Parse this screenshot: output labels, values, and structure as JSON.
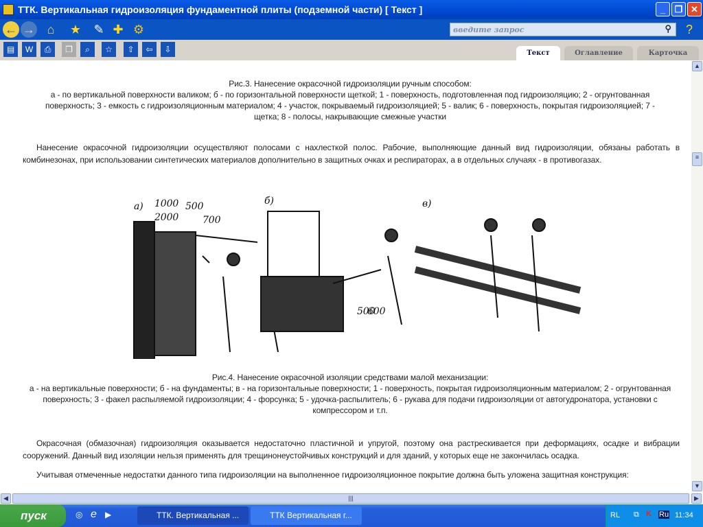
{
  "window": {
    "title": "ТТК. Вертикальная гидроизоляция фундаментной плиты (подземной части) [ Текст ]",
    "minimize": "_",
    "restore": "❐",
    "close": "✕"
  },
  "toolbar": {
    "search_placeholder": "введите запрос"
  },
  "tabs": [
    {
      "label": "Текст"
    },
    {
      "label": "Оглавление"
    },
    {
      "label": "Карточка"
    }
  ],
  "content": {
    "fig3_title": "Рис.3. Нанесение окрасочной гидроизоляции ручным способом:",
    "fig3_legend": "а - по вертикальной поверхности валиком; б - по горизонтальной поверхности щеткой; 1 - поверхность, подготовленная под гидроизоляцию; 2 - огрунтованная поверхность; 3 - емкость с гидроизоляционным материалом; 4 - участок, покрываемый гидроизоляцией; 5 - валик; 6 - поверхность, покрытая гидроизоляцией; 7 - щетка; 8 - полосы, накрывающие смежные участки",
    "para1": "Нанесение окрасочной гидроизоляции осуществляют полосами с нахлесткой полос. Рабочие, выполняющие данный вид гидроизоляции, обязаны работать в комбинезонах, при использовании синтетических материалов дополнительно в защитных очках и респираторах, а в отдельных случаях - в противогазах.",
    "figure_labels": {
      "a": "а)",
      "b": "б)",
      "c": "в)",
      "d1000": "1000",
      "d500": "500",
      "d2000": "2000",
      "d700": "700",
      "d500b": "500",
      "d600": "600"
    },
    "fig4_title": "Рис.4. Нанесение окрасочной изоляции средствами малой механизации:",
    "fig4_legend": "а - на вертикальные поверхности; б - на фундаменты; в - на горизонтальные поверхности; 1 - поверхность, покрытая гидроизоляционным материалом; 2 - огрунтованная поверхность; 3 - факел распыляемой гидроизоляции; 4 - форсунка; 5 - удочка-распылитель; 6 - рукава для подачи гидроизоляции от автогудронатора, установки с компрессором и т.п.",
    "para2": "Окрасочная (обмазочная) гидроизоляция оказывается недостаточно пластичной и упругой, поэтому она растрескивается при деформациях, осадке и вибрации сооружений. Данный вид изоляции нельзя применять для трещинонеустойчивых конструкций и для зданий, у которых еще не закончилась осадка.",
    "para3": "Учитывая отмеченные недостатки данного типа гидроизоляции на выполненное гидроизоляционное покрытие должна быть уложена защитная конструкция:"
  },
  "taskbar": {
    "start": "пуск",
    "task1": "ТТК. Вертикальная ...",
    "task2": "ТТК Вертикальная г...",
    "lang_rl": "RL",
    "lang": "Ru",
    "clock": "11:34"
  }
}
